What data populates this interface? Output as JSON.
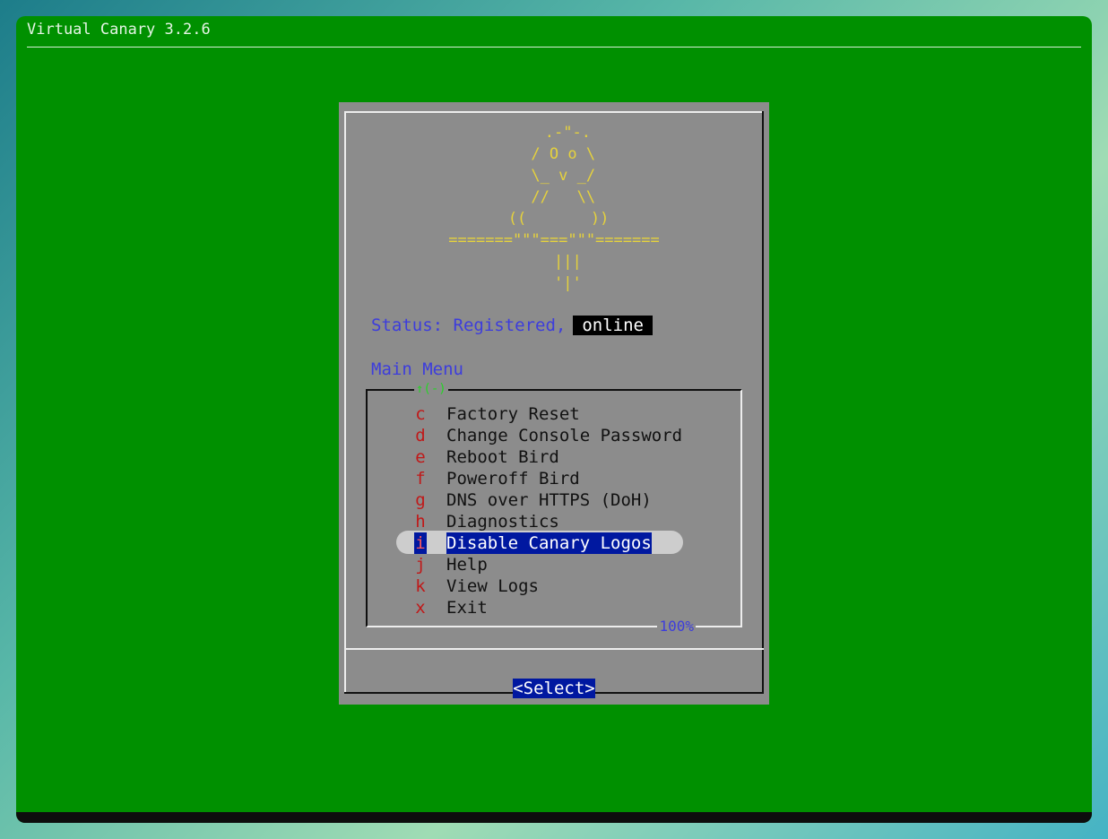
{
  "app": {
    "title": "Virtual Canary 3.2.6"
  },
  "logo_ascii": "   .-\"-.\n  / O o \\\n  \\_ v _/\n  //   \\\\\n ((       ))\n=======\"\"\"===\"\"\"=======\n   |||\n   '|'",
  "status": {
    "label": "Status: Registered,",
    "state": "online"
  },
  "menu": {
    "title": "Main Menu",
    "scroll_indicator": "↑(-)",
    "scroll_percent": "100%",
    "selected_key": "i",
    "items": [
      {
        "key": "c",
        "label": "Factory Reset"
      },
      {
        "key": "d",
        "label": "Change Console Password"
      },
      {
        "key": "e",
        "label": "Reboot Bird"
      },
      {
        "key": "f",
        "label": "Poweroff Bird"
      },
      {
        "key": "g",
        "label": "DNS over HTTPS (DoH)"
      },
      {
        "key": "h",
        "label": "Diagnostics"
      },
      {
        "key": "i",
        "label": "Disable Canary Logos"
      },
      {
        "key": "j",
        "label": "Help"
      },
      {
        "key": "k",
        "label": "View Logs"
      },
      {
        "key": "x",
        "label": "Exit"
      }
    ]
  },
  "buttons": {
    "select": "<Select>"
  },
  "colors": {
    "screen_bg": "#009000",
    "dialog_bg": "#8c8c8c",
    "accent_blue": "#3d3ddc",
    "hotkey_red": "#c01818",
    "selection_bg": "#0018a0",
    "logo_yellow": "#e6d23c"
  }
}
